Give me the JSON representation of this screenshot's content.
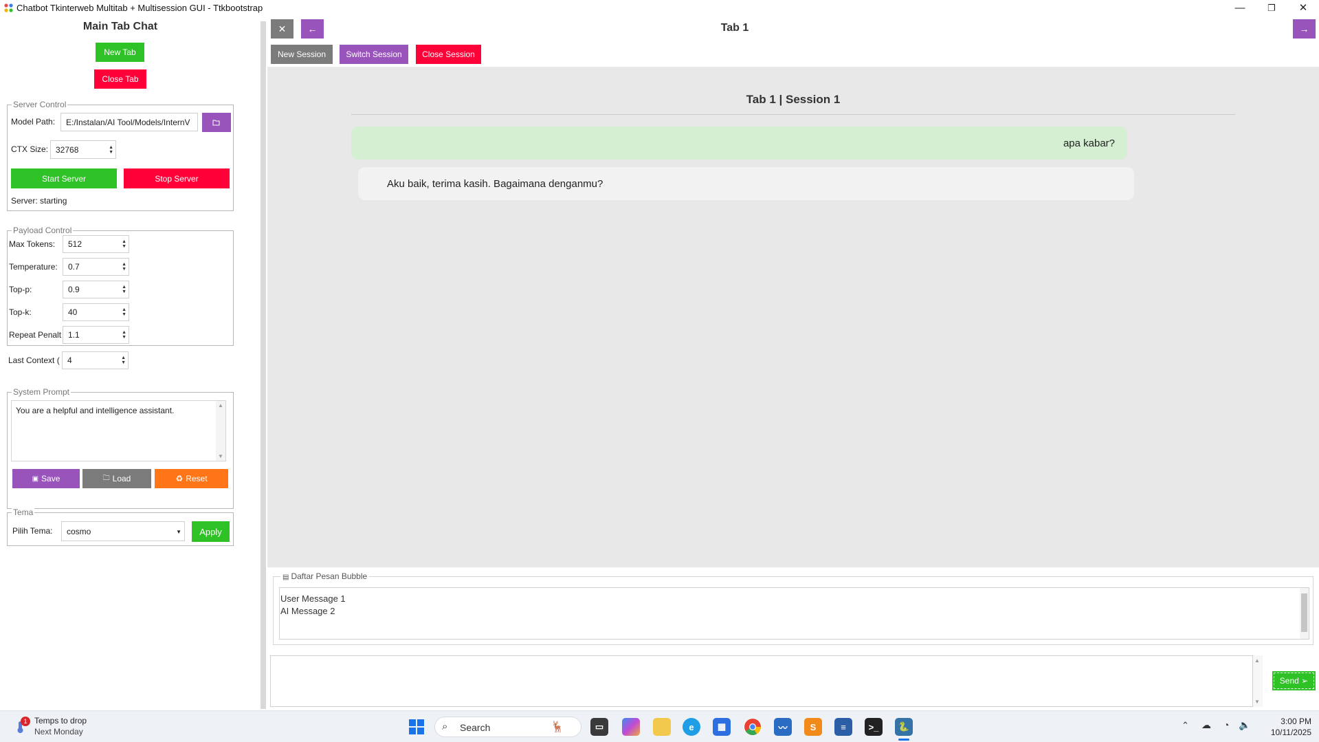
{
  "window": {
    "title": "Chatbot Tkinterweb Multitab + Multisession GUI - Ttkbootstrap",
    "minimize_glyph": "—",
    "maximize_glyph": "❐",
    "close_glyph": "✕"
  },
  "left": {
    "heading": "Main Tab Chat",
    "new_tab": "New Tab",
    "close_tab": "Close Tab",
    "server_control": {
      "title": "Server Control",
      "model_path_label": "Model Path:",
      "model_path_value": "E:/Instalan/AI Tool/Models/InternV",
      "browse_icon": "folder-icon",
      "ctx_label": "CTX Size:",
      "ctx_value": "32768",
      "start": "Start Server",
      "stop": "Stop Server",
      "status": "Server: starting"
    },
    "payload": {
      "title": "Payload Control",
      "rows": [
        {
          "label": "Max Tokens:",
          "value": "512"
        },
        {
          "label": "Temperature:",
          "value": "0.7"
        },
        {
          "label": "Top-p:",
          "value": "0.9"
        },
        {
          "label": "Top-k:",
          "value": "40"
        },
        {
          "label": "Repeat Penalt",
          "value": "1.1"
        },
        {
          "label": "Last Context (",
          "value": "4"
        }
      ]
    },
    "system_prompt": {
      "title": "System Prompt",
      "text": "You are a helpful and intelligence assistant.",
      "save": "Save",
      "load": "Load",
      "reset": "Reset"
    },
    "theme": {
      "title": "Tema",
      "label": "Pilih Tema:",
      "value": "cosmo",
      "apply": "Apply"
    }
  },
  "right": {
    "close_glyph": "✕",
    "back_glyph": "←",
    "forward_glyph": "→",
    "tab_title": "Tab 1",
    "new_session": "New Session",
    "switch_session": "Switch Session",
    "close_session": "Close Session",
    "session_title": "Tab 1 | Session 1",
    "messages": [
      {
        "role": "user",
        "text": "apa kabar?"
      },
      {
        "role": "ai",
        "text": "Aku baik, terima kasih. Bagaimana denganmu?"
      }
    ],
    "bubble_list": {
      "title": "Daftar Pesan Bubble",
      "items": [
        "User Message 1",
        "AI Message 2"
      ]
    },
    "input_value": "",
    "send": "Send ➢"
  },
  "taskbar": {
    "weather_badge": "1",
    "weather_title": "Temps to drop",
    "weather_sub": "Next Monday",
    "search": "Search",
    "time": "3:00 PM",
    "date": "10/11/2025"
  },
  "colors": {
    "green": "#2ec226",
    "red": "#ff0039",
    "purple": "#9954bb",
    "gray": "#7b7b7b",
    "orange": "#ff7518",
    "user_bubble": "#d4efd2",
    "ai_bubble": "#f2f2f2"
  }
}
